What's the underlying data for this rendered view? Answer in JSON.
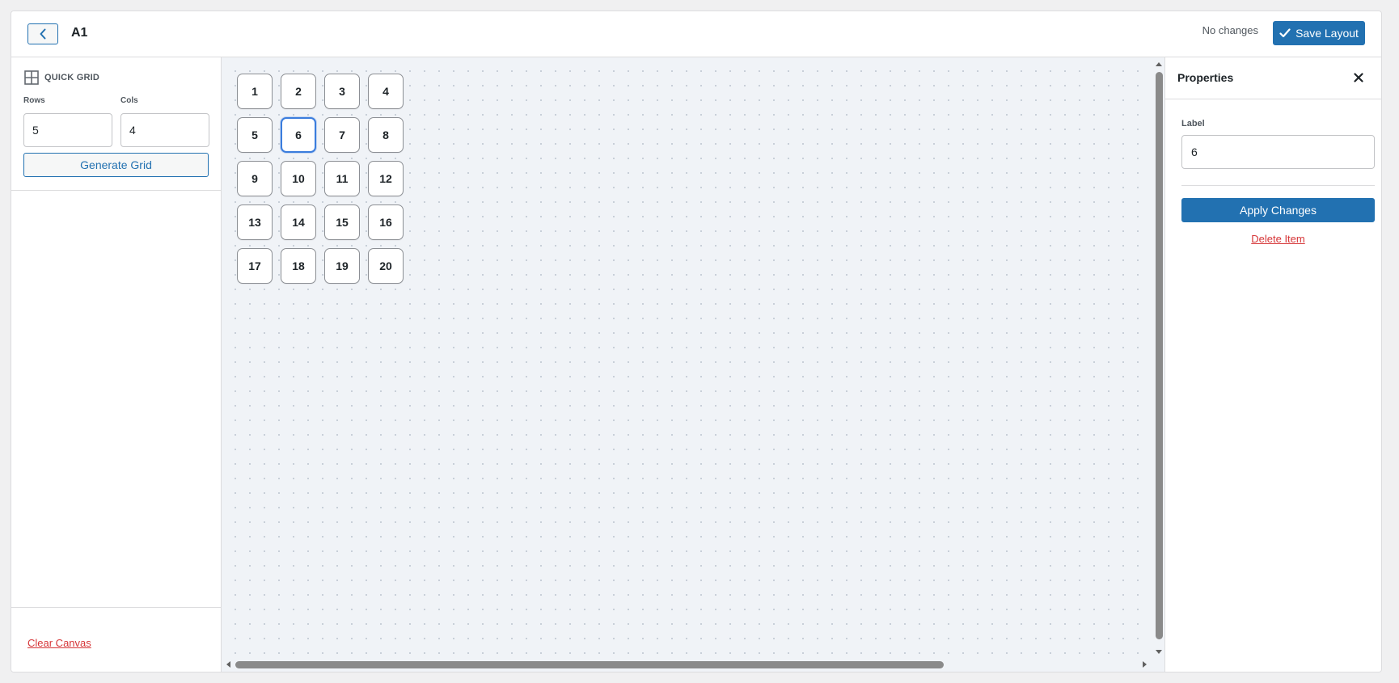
{
  "header": {
    "title": "A1",
    "status": "No changes",
    "save_label": "Save Layout"
  },
  "sidebar": {
    "quick_grid_title": "QUICK GRID",
    "rows_label": "Rows",
    "rows_value": "5",
    "cols_label": "Cols",
    "cols_value": "4",
    "generate_label": "Generate Grid",
    "clear_label": "Clear Canvas"
  },
  "canvas": {
    "items": [
      "1",
      "2",
      "3",
      "4",
      "5",
      "6",
      "7",
      "8",
      "9",
      "10",
      "11",
      "12",
      "13",
      "14",
      "15",
      "16",
      "17",
      "18",
      "19",
      "20"
    ],
    "selected": "6"
  },
  "properties": {
    "title": "Properties",
    "label_caption": "Label",
    "label_value": "6",
    "apply_label": "Apply Changes",
    "delete_label": "Delete Item"
  },
  "colors": {
    "accent": "#2271b1",
    "danger": "#d63638",
    "selected_border": "#3b7ddd"
  }
}
